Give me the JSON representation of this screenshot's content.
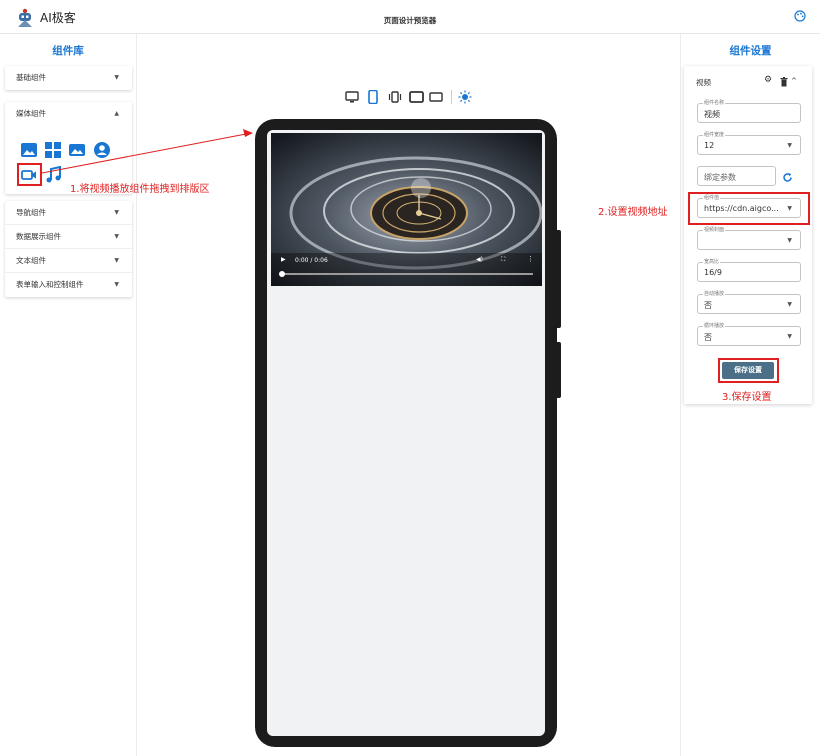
{
  "app": {
    "name": "AI极客",
    "page_title": "页面设计预览器"
  },
  "left_panel": {
    "title": "组件库",
    "groups": [
      {
        "label": "基础组件"
      },
      {
        "label": "媒体组件"
      },
      {
        "label": "导航组件"
      },
      {
        "label": "数据展示组件"
      },
      {
        "label": "文本组件"
      },
      {
        "label": "表单输入和控制组件"
      }
    ],
    "media_icons": [
      "image-icon",
      "grid-icon",
      "landscape-icon",
      "avatar-icon",
      "video-camera-icon",
      "music-note-icon"
    ]
  },
  "preview": {
    "device_icons": [
      "desktop-icon",
      "phone-icon",
      "vibrate-phone-icon",
      "tablet-landscape-icon",
      "monitor-icon",
      "theme-toggle-icon"
    ],
    "video": {
      "time": "0:00 / 0:06",
      "progress": 0.0
    }
  },
  "right_panel": {
    "title": "组件设置",
    "component_name_header": "视频",
    "fields": {
      "component_name": {
        "label": "组件名称",
        "value": "视频"
      },
      "component_width": {
        "label": "组件宽度",
        "value": "12"
      },
      "bind_param": {
        "placeholder": "绑定参数"
      },
      "component_value": {
        "label": "组件值",
        "value": "https://cdn.aigco..."
      },
      "video_cover": {
        "label": "视频封面",
        "value": ""
      },
      "aspect_ratio": {
        "label": "宽高比",
        "value": "16/9"
      },
      "autoplay": {
        "label": "自动播放",
        "value": "否"
      },
      "loop": {
        "label": "循环播放",
        "value": "否"
      }
    },
    "save_label": "保存设置"
  },
  "annotations": {
    "step1": "1.将视频播放组件拖拽到排版区",
    "step2": "2.设置视频地址",
    "step3": "3.保存设置"
  },
  "colors": {
    "accent": "#1976d2",
    "annotation": "#e02020",
    "save_button": "#4a6f86"
  }
}
